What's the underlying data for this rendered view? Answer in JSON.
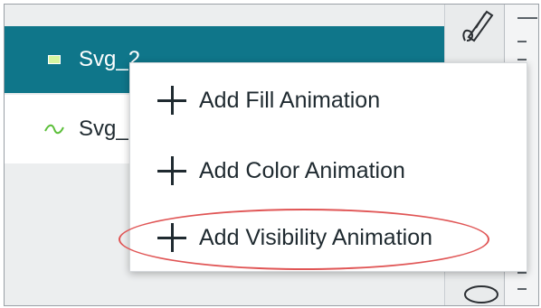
{
  "layers": {
    "items": [
      {
        "label": "Svg_2",
        "icon": "rectangle-icon",
        "selected": true
      },
      {
        "label": "Svg_",
        "icon": "wave-icon",
        "selected": false
      }
    ]
  },
  "context_menu": {
    "items": [
      {
        "label": "Add Fill Animation",
        "icon": "plus-icon"
      },
      {
        "label": "Add Color Animation",
        "icon": "plus-icon"
      },
      {
        "label": "Add Visibility Animation",
        "icon": "plus-icon",
        "highlighted": true
      }
    ]
  },
  "toolstrip": {
    "top_icon": "pen-tool-icon",
    "bottom_icon": "ellipse-icon"
  },
  "colors": {
    "selected_row": "#0f768a",
    "highlight": "#e05555",
    "wave": "#5cbf3a"
  }
}
